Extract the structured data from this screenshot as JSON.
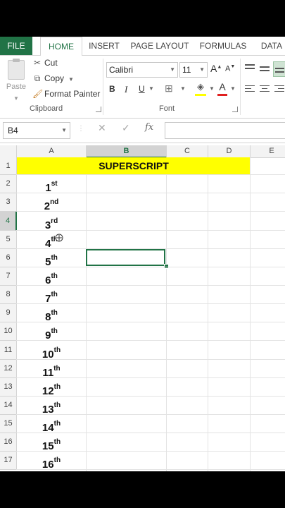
{
  "ribbon": {
    "tabs": [
      "FILE",
      "HOME",
      "INSERT",
      "PAGE LAYOUT",
      "FORMULAS",
      "DATA"
    ],
    "active_tab": "HOME",
    "clipboard": {
      "paste_label": "Paste",
      "cut_label": "Cut",
      "copy_label": "Copy",
      "format_painter_label": "Format Painter",
      "group_label": "Clipboard"
    },
    "font": {
      "font_name": "Calibri",
      "font_size": "11",
      "group_label": "Font",
      "bold": "B",
      "italic": "I",
      "underline": "U",
      "grow": "A",
      "shrink": "A",
      "font_color": "A"
    }
  },
  "formula_bar": {
    "name_box": "B4",
    "fx_label": "fx",
    "value": ""
  },
  "sheet": {
    "columns": [
      "A",
      "B",
      "C",
      "D",
      "E"
    ],
    "selected_column": "B",
    "rows": [
      "1",
      "2",
      "3",
      "4",
      "5",
      "6",
      "7",
      "8",
      "9",
      "10",
      "11",
      "12",
      "13",
      "14",
      "15",
      "16",
      "17"
    ],
    "selected_row": "4",
    "title": "SUPERSCRIPT",
    "title_fill": "#ffff00",
    "accent": "#217346",
    "ordinals": [
      {
        "num": "1",
        "sup": "st"
      },
      {
        "num": "2",
        "sup": "nd"
      },
      {
        "num": "3",
        "sup": "rd"
      },
      {
        "num": "4",
        "sup": "th"
      },
      {
        "num": "5",
        "sup": "th"
      },
      {
        "num": "6",
        "sup": "th"
      },
      {
        "num": "7",
        "sup": "th"
      },
      {
        "num": "8",
        "sup": "th"
      },
      {
        "num": "9",
        "sup": "th"
      },
      {
        "num": "10",
        "sup": "th"
      },
      {
        "num": "11",
        "sup": "th"
      },
      {
        "num": "12",
        "sup": "th"
      },
      {
        "num": "13",
        "sup": "th"
      },
      {
        "num": "14",
        "sup": "th"
      },
      {
        "num": "15",
        "sup": "th"
      },
      {
        "num": "16",
        "sup": "th"
      }
    ]
  }
}
